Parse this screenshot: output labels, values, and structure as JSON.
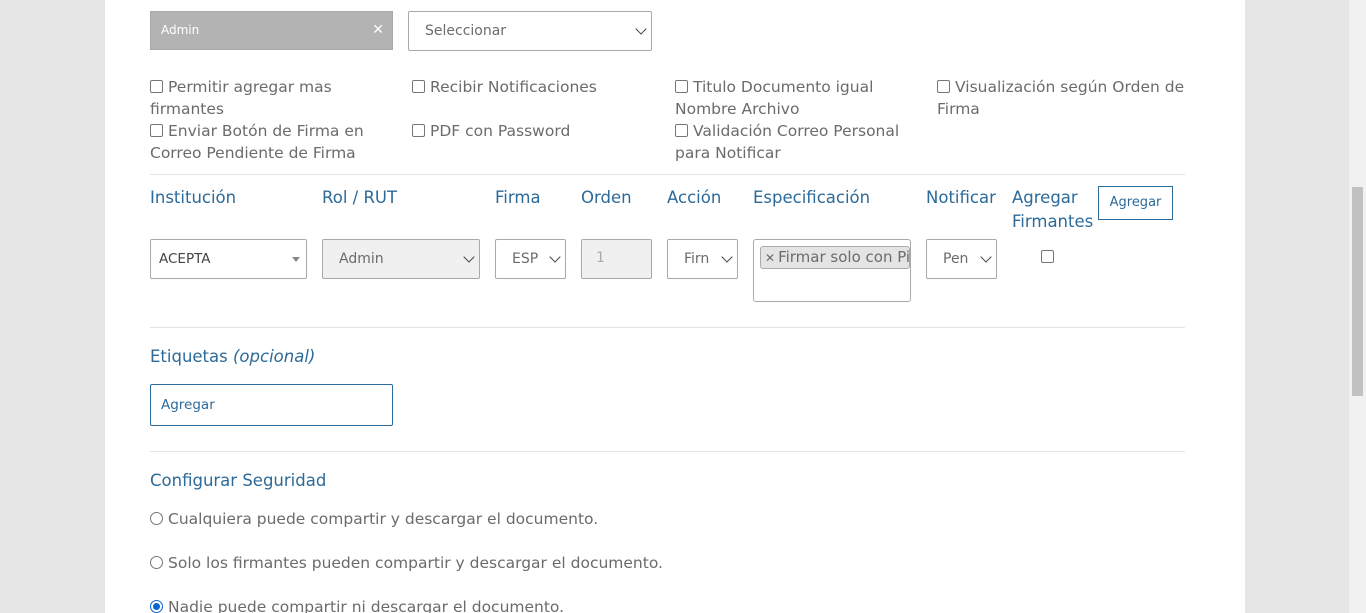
{
  "top_row": {
    "user_tag": "Admin",
    "select_value": "Seleccionar"
  },
  "options": [
    "Permitir agregar mas firmantes",
    "Recibir Notificaciones",
    "Titulo Documento igual Nombre Archivo",
    "Visualización según Orden de Firma",
    "Enviar Botón de Firma en Correo Pendiente de Firma",
    "PDF con Password",
    "Validación Correo Personal para Notificar"
  ],
  "signers": {
    "headers": {
      "institution": "Institución",
      "role": "Rol / RUT",
      "signature": "Firma",
      "order": "Orden",
      "action": "Acción",
      "specification": "Especificación",
      "notify": "Notificar",
      "add_signers": "Agregar Firmantes"
    },
    "add_button": "Agregar",
    "row": {
      "institution": "ACEPTA",
      "role": "Admin",
      "signature": "ESP",
      "order": "1",
      "action": "Firn",
      "specification_chip": "Firmar solo con Pin",
      "notify": "Pen"
    }
  },
  "tags": {
    "title": "Etiquetas",
    "optional": "(opcional)",
    "input_value": "Agregar"
  },
  "security": {
    "title": "Configurar Seguridad",
    "options": [
      "Cualquiera puede compartir y descargar el documento.",
      "Solo los firmantes pueden compartir y descargar el documento.",
      "Nadie puede compartir ni descargar el documento."
    ],
    "selected_index": 2
  },
  "colors": {
    "accent": "#2c6a99",
    "radio_selected": "#0a64d6"
  }
}
